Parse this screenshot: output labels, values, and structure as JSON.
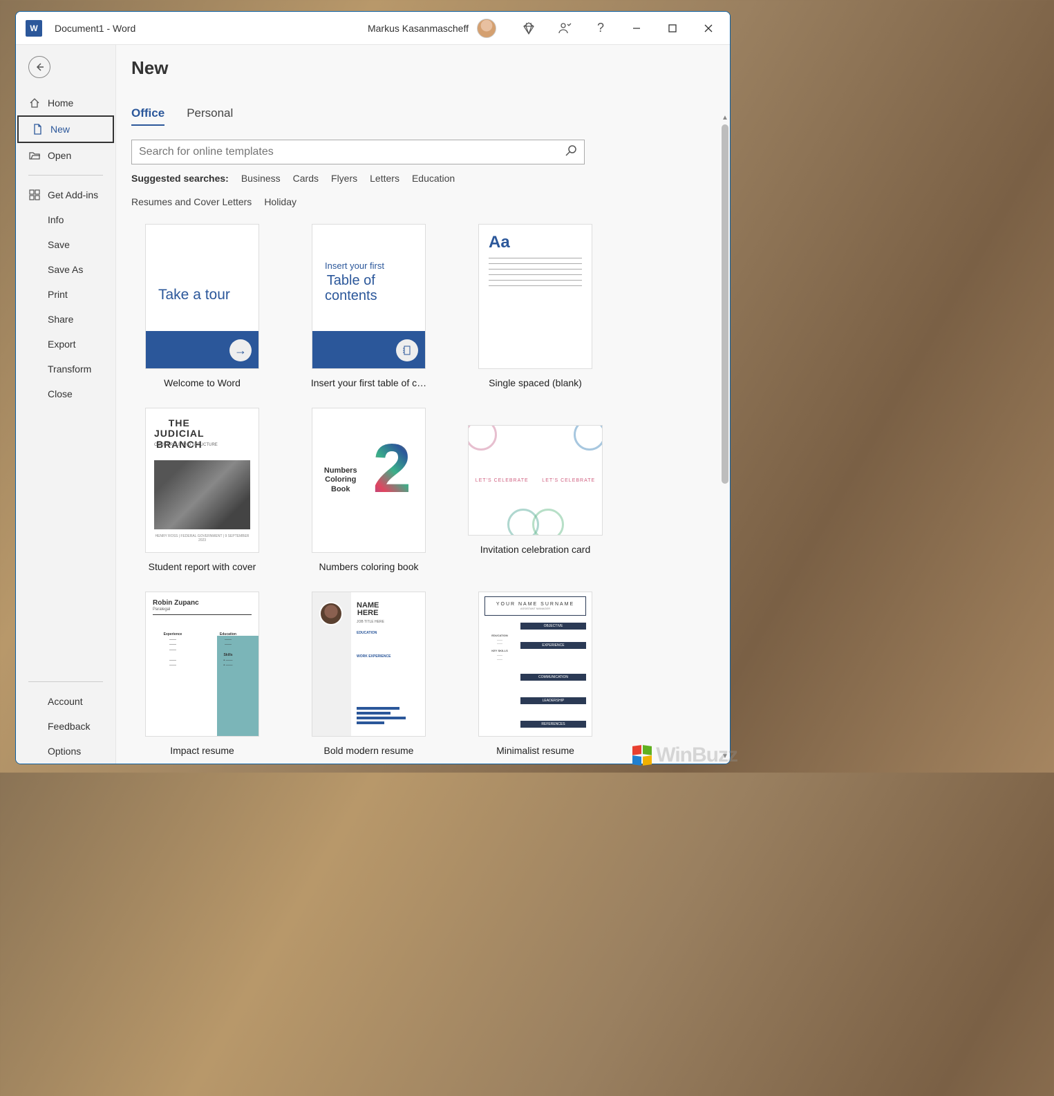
{
  "titlebar": {
    "doc_title": "Document1  -  Word",
    "username": "Markus Kasanmascheff"
  },
  "sidebar": {
    "nav": [
      {
        "id": "home",
        "label": "Home",
        "icon": "home"
      },
      {
        "id": "new",
        "label": "New",
        "icon": "doc",
        "active": true
      },
      {
        "id": "open",
        "label": "Open",
        "icon": "folder"
      }
    ],
    "get_addins": "Get Add-ins",
    "sub": [
      "Info",
      "Save",
      "Save As",
      "Print",
      "Share",
      "Export",
      "Transform",
      "Close"
    ],
    "bottom": [
      "Account",
      "Feedback",
      "Options"
    ]
  },
  "main": {
    "page_title": "New",
    "tabs": [
      {
        "label": "Office",
        "active": true
      },
      {
        "label": "Personal",
        "active": false
      }
    ],
    "search_placeholder": "Search for online templates",
    "suggested_label": "Suggested searches:",
    "suggested": [
      "Business",
      "Cards",
      "Flyers",
      "Letters",
      "Education",
      "Resumes and Cover Letters",
      "Holiday"
    ],
    "templates": [
      {
        "id": "tour",
        "label": "Welcome to Word",
        "thumb_text1": "Take a tour"
      },
      {
        "id": "toc",
        "label": "Insert your first table of c…",
        "thumb_small": "Insert your first",
        "thumb_large": "Table of\ncontents"
      },
      {
        "id": "blank",
        "label": "Single spaced (blank)",
        "thumb_text1": "Aa"
      },
      {
        "id": "report",
        "label": "Student report with cover",
        "thumb_head": "THE\nJUDICIAL\nBRANCH",
        "thumb_sub": "COURT ROLE AND STRUCTURE"
      },
      {
        "id": "numbers",
        "label": "Numbers coloring book",
        "thumb_text1": "Numbers Coloring Book"
      },
      {
        "id": "invite",
        "label": "Invitation celebration card",
        "thumb_text1": "LET'S CELEBRATE",
        "wide": true
      },
      {
        "id": "impact",
        "label": "Impact resume",
        "thumb_name": "Robin Zupanc",
        "thumb_role": "Paralegal"
      },
      {
        "id": "bold",
        "label": "Bold modern resume",
        "thumb_name": "NAME\nHERE",
        "thumb_role": "JOB TITLE HERE"
      },
      {
        "id": "min",
        "label": "Minimalist resume",
        "thumb_name": "YOUR NAME SURNAME",
        "thumb_role": "ASSISTANT MANAGER",
        "bands": [
          "OBJECTIVE",
          "EXPERIENCE",
          "COMMUNICATION",
          "LEADERSHIP",
          "REFERENCES"
        ]
      }
    ]
  },
  "watermark": "WinBuzz"
}
